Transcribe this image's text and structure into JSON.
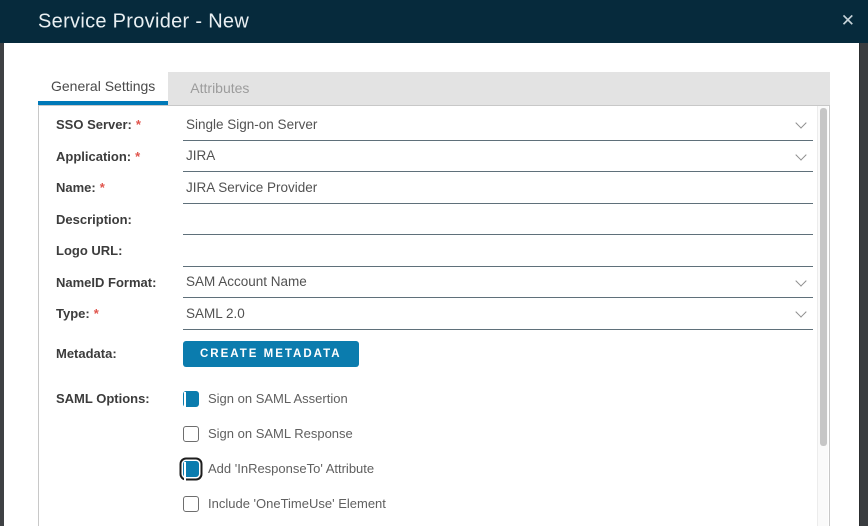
{
  "modal": {
    "title": "Service Provider - New",
    "close_icon": "✕"
  },
  "tabs": {
    "general": "General Settings",
    "attributes": "Attributes"
  },
  "form": {
    "required_marker": "*",
    "fields": [
      {
        "label": "SSO Server:",
        "required": true,
        "control": "select",
        "value": "Single Sign-on Server"
      },
      {
        "label": "Application:",
        "required": true,
        "control": "select",
        "value": "JIRA"
      },
      {
        "label": "Name:",
        "required": true,
        "control": "text",
        "value": "JIRA Service Provider"
      },
      {
        "label": "Description:",
        "required": false,
        "control": "text",
        "value": ""
      },
      {
        "label": "Logo URL:",
        "required": false,
        "control": "text",
        "value": ""
      },
      {
        "label": "NameID Format:",
        "required": false,
        "control": "select",
        "value": "SAM Account Name"
      },
      {
        "label": "Type:",
        "required": true,
        "control": "select",
        "value": "SAML 2.0"
      }
    ],
    "metadata": {
      "label": "Metadata:",
      "button_label": "CREATE METADATA"
    },
    "saml_options": {
      "label": "SAML Options:",
      "options": [
        {
          "label": "Sign on SAML Assertion",
          "checked": true,
          "focused": false
        },
        {
          "label": "Sign on SAML Response",
          "checked": false,
          "focused": false
        },
        {
          "label": "Add 'InResponseTo' Attribute",
          "checked": true,
          "focused": true
        },
        {
          "label": "Include 'OneTimeUse' Element",
          "checked": false,
          "focused": false
        }
      ]
    }
  },
  "colors": {
    "header_bg": "#062a3c",
    "accent_blue": "#0b7cae",
    "tab_underline_blue": "#0079b8",
    "required_red": "#e0544c",
    "field_underline": "#5f707a",
    "page_edge_dark": "#3e4144"
  }
}
